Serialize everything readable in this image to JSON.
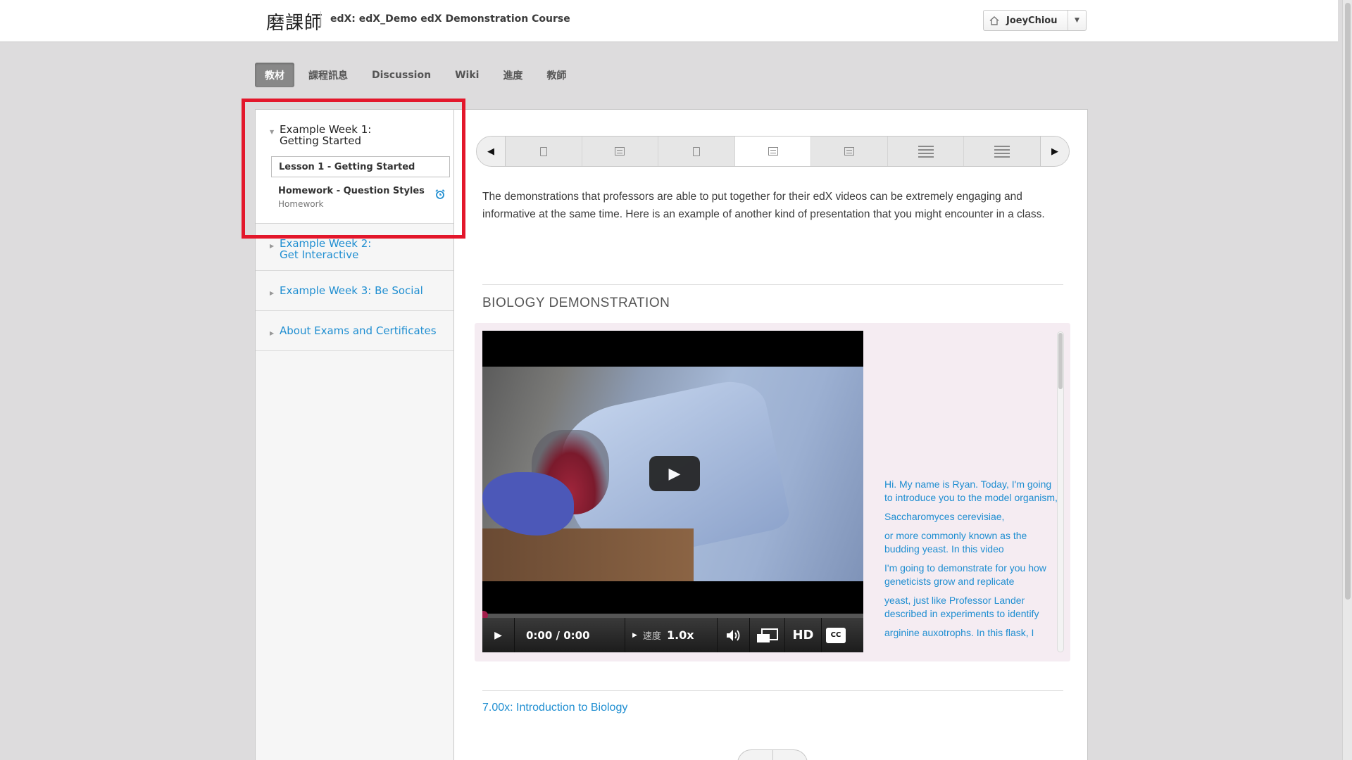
{
  "header": {
    "logo_text": "磨課師",
    "course_title": "edX: edX_Demo edX Demonstration Course",
    "user_name": "JoeyChiou"
  },
  "tabs": [
    {
      "label": "教材",
      "active": true
    },
    {
      "label": "課程訊息"
    },
    {
      "label": "Discussion"
    },
    {
      "label": "Wiki"
    },
    {
      "label": "進度"
    },
    {
      "label": "教師"
    }
  ],
  "sidebar": {
    "chapters": [
      {
        "title_line1": "Example Week 1:",
        "title_line2": "Getting Started",
        "open": true
      },
      {
        "title_line1": "Example Week 2:",
        "title_line2": "Get Interactive"
      },
      {
        "title": "Example Week 3: Be Social"
      },
      {
        "title": "About Exams and Certificates"
      }
    ],
    "lessons": [
      {
        "title": "Lesson 1 - Getting Started",
        "active": true
      },
      {
        "title": "Homework - Question Styles",
        "subtitle": "Homework",
        "icon": "alarm-clock-icon"
      }
    ]
  },
  "sequence_nav": {
    "items": [
      "document-icon",
      "video-icon",
      "document-icon",
      "video-icon",
      "video-icon",
      "problem-list-icon",
      "problem-list-icon"
    ],
    "active_index": 3
  },
  "content": {
    "intro": "The demonstrations that professors are able to put together for their edX videos can be extremely engaging and informative at the same time. Here is an example of another kind of presentation that you might encounter in a class.",
    "section_title": "BIOLOGY DEMONSTRATION",
    "video": {
      "time": "0:00 / 0:00",
      "speed_label": "速度",
      "speed": "1.0x",
      "hd_label": "HD",
      "cc_label": "CC",
      "progress": 0
    },
    "transcript": [
      "Hi. My name is Ryan. Today, I'm going to introduce you to the model organism,",
      "Saccharomyces cerevisiae,",
      "or more commonly known as the budding yeast. In this video",
      "I'm going to demonstrate for you how geneticists grow and replicate",
      "yeast, just like Professor Lander described in experiments to identify",
      "arginine auxotrophs. In this flask, I"
    ],
    "course_link": "7.00x: Introduction to Biology"
  },
  "colors": {
    "link_blue": "#1f8ed1",
    "highlight_red": "#e3172b",
    "active_tab": "#888888"
  }
}
